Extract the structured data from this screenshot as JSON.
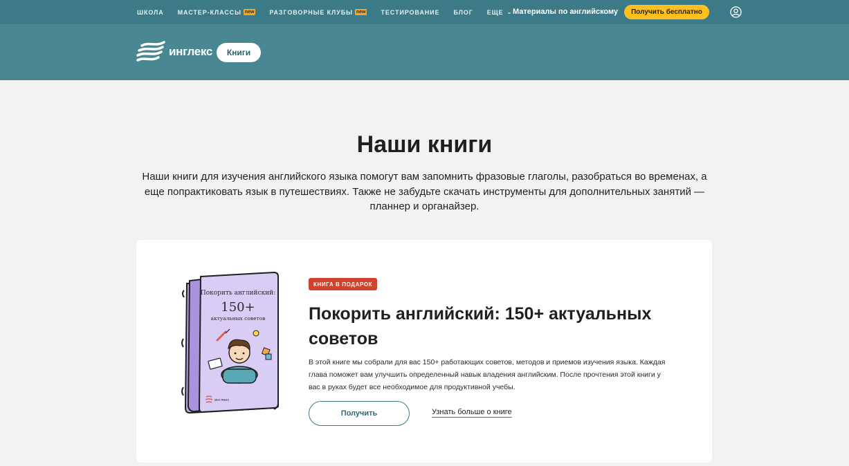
{
  "topnav": {
    "items": [
      {
        "label": "ШКОЛА"
      },
      {
        "label": "МАСТЕР-КЛАССЫ",
        "badge": "new"
      },
      {
        "label": "РАЗГОВОРНЫЕ КЛУБЫ",
        "badge": "new"
      },
      {
        "label": "ТЕСТИРОВАНИЕ"
      },
      {
        "label": "БЛОГ"
      },
      {
        "label": "ЕЩЕ"
      }
    ],
    "materials_label": "Материалы по английскому",
    "cta_label": "Получить бесплатно"
  },
  "header": {
    "logo_text": "инглекс",
    "section_pill": "Книги"
  },
  "hero": {
    "title": "Наши книги",
    "intro": "Наши книги для изучения английского языка помогут вам запомнить фразовые глаголы, разобраться во временах, а еще попрактиковать язык в путешествиях. Также не забудьте скачать инструменты для дополнительных занятий — планнер и органайзер."
  },
  "book_card": {
    "tag": "КНИГА В ПОДАРОК",
    "title": "Покорить английский: 150+ актуальных советов",
    "description": "В этой книге мы собрали для вас 150+ работающих советов, методов и приемов изучения языка. Каждая глава поможет вам улучшить определенный навык владения английским. После прочтения этой книги у вас в руках будет все необходимое для продуктивной учебы.",
    "get_button": "Получить",
    "more_link": "Узнать больше о книге",
    "cover": {
      "line1": "Покорить английский:",
      "line2": "150+",
      "line3": "актуальных советов",
      "brand": "инглекс"
    }
  },
  "colors": {
    "topbar": "#3d7a87",
    "header": "#498893",
    "accent_yellow": "#ffbf1f",
    "tag_red": "#cf432e",
    "page_bg": "#f3f2f0"
  }
}
